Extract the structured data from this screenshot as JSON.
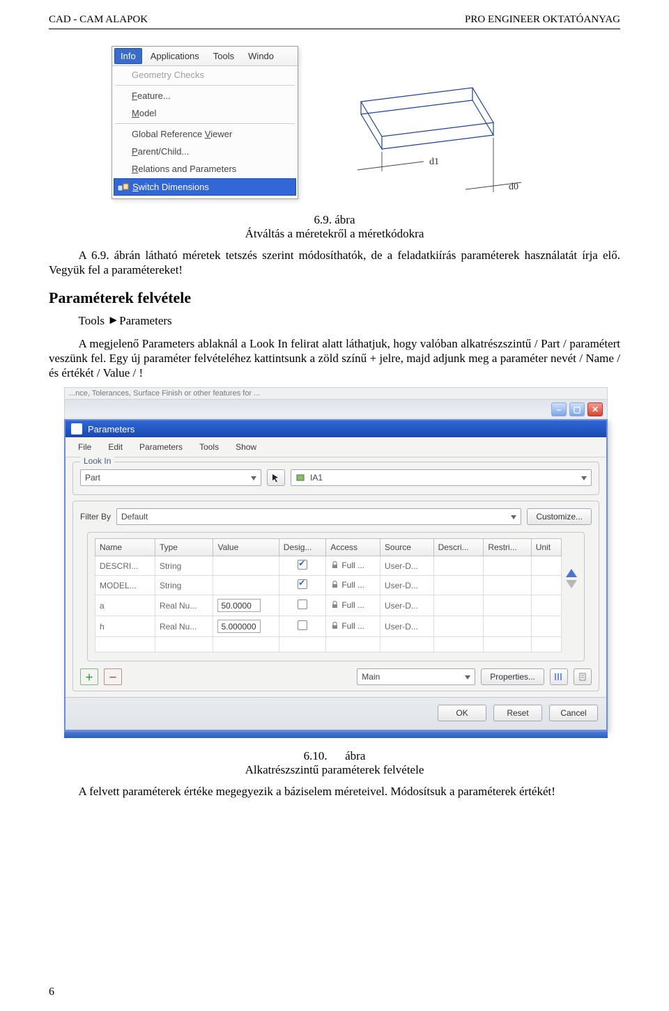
{
  "header": {
    "left": "CAD - CAM ALAPOK",
    "right": "PRO ENGINEER OKTATÓANYAG"
  },
  "page_number": "6",
  "info_menu": {
    "menubar": [
      "Info",
      "Applications",
      "Tools",
      "Windo"
    ],
    "items": [
      {
        "label": "Geometry Checks",
        "disabled": true
      },
      {
        "label": "Feature...",
        "mnemonic": "F"
      },
      {
        "label": "Model",
        "mnemonic": "M"
      },
      "sep",
      {
        "label": "Global Reference Viewer",
        "mnemonic": "V"
      },
      {
        "label": "Parent/Child...",
        "mnemonic": "P"
      },
      {
        "label": "Relations and Parameters",
        "mnemonic": "R"
      },
      {
        "label": "Switch Dimensions",
        "mnemonic": "S",
        "highlight": true,
        "icon": "switch-dimensions-icon"
      }
    ]
  },
  "wireframe": {
    "dims": [
      "d1",
      "d0"
    ]
  },
  "fig69": {
    "caption_no": "6.9. ábra",
    "caption": "Átváltás a méretekről a méretkódokra"
  },
  "para1": "A 6.9. ábrán látható méretek tetszés szerint módosíthatók, de a feladatkiírás paraméterek használatát írja elő. Vegyük fel a paramétereket!",
  "section_title": "Paraméterek felvétele",
  "tool_line": {
    "a": "Tools",
    "b": "Parameters"
  },
  "para2": "A megjelenő Parameters ablaknál a Look In felirat alatt láthatjuk, hogy valóban alkatrészszintű / Part / paramétert veszünk fel. Egy új paraméter felvételéhez kattintsunk a zöld színű + jelre, majd adjunk meg a paraméter nevét / Name / és értékét / Value / !",
  "dlg": {
    "topstrip": "...nce, Tolerances, Surface Finish or other features for ...",
    "title": "Parameters",
    "menubar": [
      "File",
      "Edit",
      "Parameters",
      "Tools",
      "Show"
    ],
    "lookin_legend": "Look In",
    "lookin_part": "Part",
    "lookin_partname": "IA1",
    "filterby_label": "Filter By",
    "filterby_value": "Default",
    "customize": "Customize...",
    "columns": [
      "Name",
      "Type",
      "Value",
      "Desig...",
      "Access",
      "Source",
      "Descri...",
      "Restri...",
      "Unit"
    ],
    "rows": [
      {
        "name": "DESCRI...",
        "type": "String",
        "value": "",
        "editable": false,
        "desig": true,
        "access": "Full ...",
        "source": "User-D...",
        "descri": "",
        "restri": "",
        "unit": ""
      },
      {
        "name": "MODEL...",
        "type": "String",
        "value": "",
        "editable": false,
        "desig": true,
        "access": "Full ...",
        "source": "User-D...",
        "descri": "",
        "restri": "",
        "unit": ""
      },
      {
        "name": "a",
        "type": "Real Nu...",
        "value": "50.0000",
        "editable": true,
        "desig": false,
        "access": "Full ...",
        "source": "User-D...",
        "descri": "",
        "restri": "",
        "unit": ""
      },
      {
        "name": "h",
        "type": "Real Nu...",
        "value": "5.000000",
        "editable": true,
        "desig": false,
        "access": "Full ...",
        "source": "User-D...",
        "descri": "",
        "restri": "",
        "unit": ""
      }
    ],
    "main_combo": "Main",
    "properties": "Properties...",
    "ok": "OK",
    "reset": "Reset",
    "cancel": "Cancel"
  },
  "fig610": {
    "caption_no": "6.10.",
    "caption_word": "ábra",
    "caption": "Alkatrészszintű paraméterek felvétele"
  },
  "para3": "A felvett paraméterek értéke megegyezik a báziselem méreteivel. Módosítsuk a paraméterek értékét!"
}
